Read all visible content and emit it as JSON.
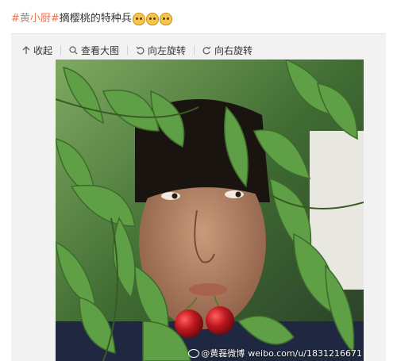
{
  "post": {
    "hashtag": "#黄小厨#",
    "text": "摘樱桃的特种兵",
    "emoji_icon": "cat-face-emoji",
    "emoji_count": 3
  },
  "toolbar": {
    "collapse_label": "收起",
    "view_large_label": "查看大图",
    "rotate_left_label": "向左旋转",
    "rotate_right_label": "向右旋转"
  },
  "photo": {
    "watermark_handle": "@黄磊微博",
    "watermark_url": "weibo.com/u/1831216671"
  },
  "colors": {
    "hashtag": "#eb7350",
    "leaf": "#5f9f45",
    "cherry": "#b5121b"
  }
}
